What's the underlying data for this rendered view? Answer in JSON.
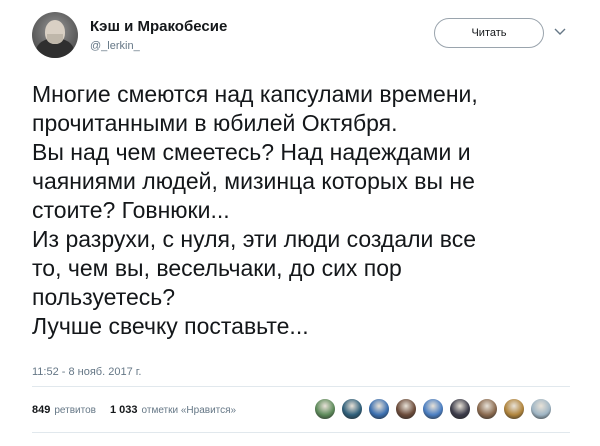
{
  "header": {
    "display_name": "Кэш и Мракобесие",
    "handle": "@_lerkin_",
    "follow_label": "Читать",
    "more_icon": "chevron-down-icon"
  },
  "tweet": {
    "lines": [
      "Многие смеются над капсулами времени,",
      "прочитанными в юбилей Октября.",
      "Вы над чем смеетесь? Над надеждами и",
      "чаяниями людей, мизинца которых вы не",
      "стоите? Говнюки...",
      "Из разрухи, с нуля, эти люди создали все",
      "то, чем вы, весельчаки, до сих пор",
      "пользуетесь?",
      "Лучше свечку поставьте..."
    ],
    "timestamp": "11:52 - 8 нояб. 2017 г."
  },
  "stats": {
    "retweets_count": "849",
    "retweets_label": "ретвитов",
    "likes_count": "1 033",
    "likes_label": "отметки «Нравится»"
  },
  "likers": [
    {
      "icon": "avatar",
      "color": "#5d8a5a"
    },
    {
      "icon": "avatar",
      "color": "#2f5f7a"
    },
    {
      "icon": "avatar",
      "color": "#3b6fb0"
    },
    {
      "icon": "avatar",
      "color": "#6b4b3a"
    },
    {
      "icon": "avatar",
      "color": "#4a7ec2"
    },
    {
      "icon": "avatar",
      "color": "#3c3c4a"
    },
    {
      "icon": "avatar",
      "color": "#8a6a4f"
    },
    {
      "icon": "avatar",
      "color": "#b0843c"
    },
    {
      "icon": "avatar",
      "color": "#9fb5c4"
    }
  ]
}
